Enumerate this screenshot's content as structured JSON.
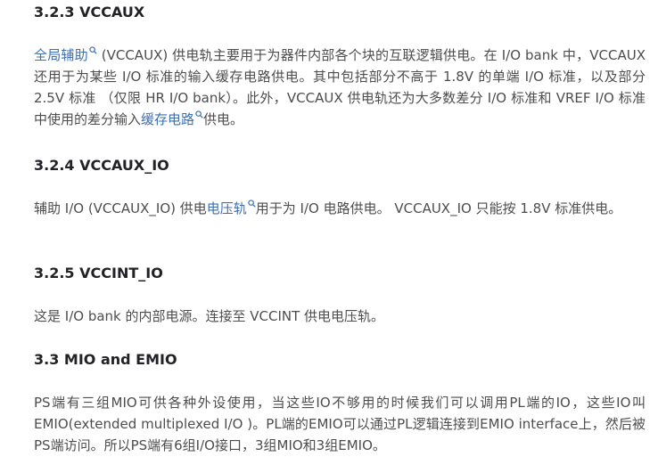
{
  "sections": {
    "s323": {
      "heading": "3.2.3 VCCAUX",
      "p_link1": "全局辅助",
      "p_part1": " (VCCAUX) 供电轨主要用于为器件内部各个块的互联逻辑供电。在 I/O bank 中，VCCAUX 还用于为某些 I/O 标准的输入缓存电路供电。其中包括部分不高于 1.8V 的单端 I/O 标准，以及部分 2.5V 标准 （仅限 HR I/O bank）。此外，VCCAUX 供电轨还为大多数差分 I/O 标准和 VREF I/O 标准中使用的差分输入",
      "p_link2": "缓存电路",
      "p_part2": "供电。"
    },
    "s324": {
      "heading": "3.2.4 VCCAUX_IO",
      "p_part1": "辅助 I/O (VCCAUX_IO) 供电",
      "p_link1": "电压轨",
      "p_part2": "用于为 I/O 电路供电。 VCCAUX_IO 只能按 1.8V 标准供电。"
    },
    "s325": {
      "heading": "3.2.5 VCCINT_IO",
      "p": "这是 I/O bank 的内部电源。连接至 VCCINT 供电电压轨。"
    },
    "s33": {
      "heading": "3.3 MIO and EMIO",
      "p": "PS端有三组MIO可供各种外设使用，当这些IO不够用的时候我们可以调用PL端的IO，这些IO叫EMIO(extended multiplexed I/O )。PL端的EMIO可以通过PL逻辑连接到EMIO interface上，然后被PS端访问。所以PS端有6组I/O接口，3组MIO和3组EMIO。"
    }
  },
  "colors": {
    "heading": "#222226",
    "body_text": "#4d4d4d",
    "link": "#3b6fb6"
  },
  "icons": {
    "keyword_link": "search-icon"
  }
}
